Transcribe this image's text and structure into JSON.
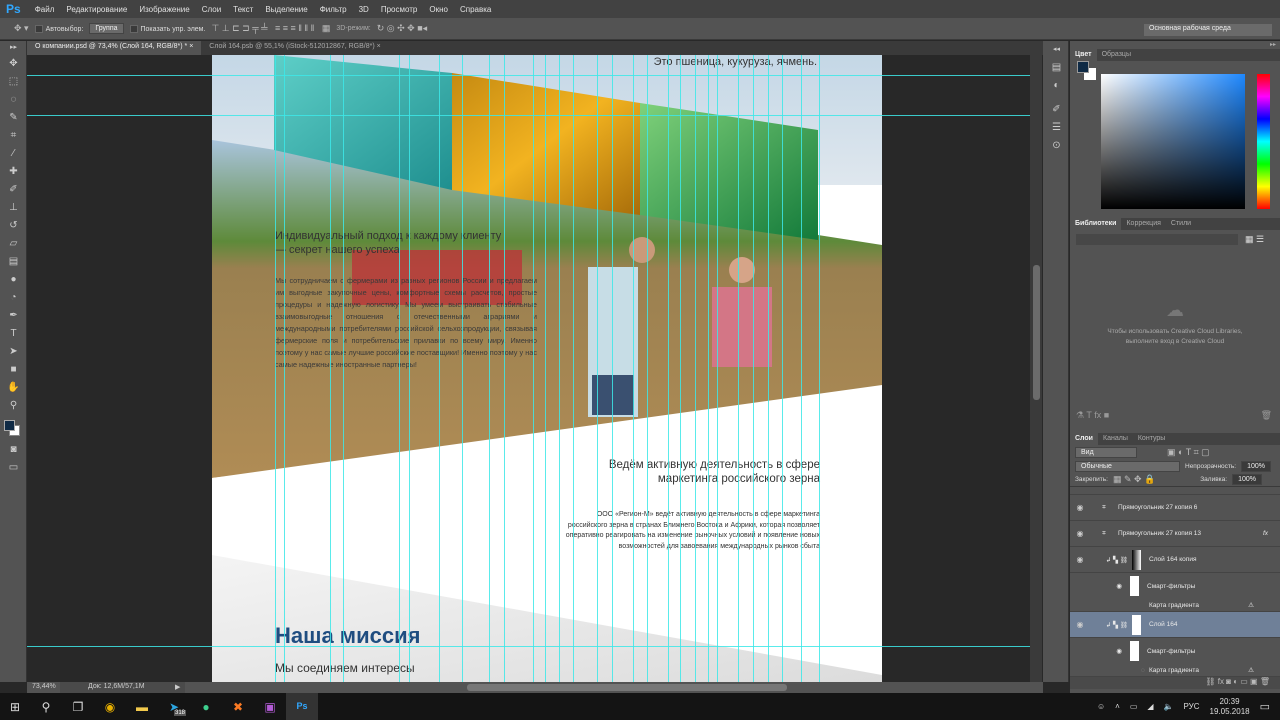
{
  "app": {
    "logo": "Ps"
  },
  "menu": [
    "Файл",
    "Редактирование",
    "Изображение",
    "Слои",
    "Текст",
    "Выделение",
    "Фильтр",
    "3D",
    "Просмотр",
    "Окно",
    "Справка"
  ],
  "options": {
    "autoselect": "Автовыбор:",
    "group": "Группа",
    "show_controls": "Показать упр. элем.",
    "mode3d": "3D-режим:",
    "workspace": "Основная рабочая среда"
  },
  "tabs": [
    {
      "label": "О компании.psd @ 73,4% (Слой 164, RGB/8*) *"
    },
    {
      "label": "Слой 164.psb @ 55,1% (iStock-512012867, RGB/8*)"
    }
  ],
  "document": {
    "top_text": "Это пшеница, кукуруза, ячмень.",
    "heading1": "Индивидуальный подход к каждому клиенту — секрет нашего успеха",
    "para1": "Мы сотрудничаем с фермерами из разных регионов России и предлагаем им выгодные закупочные цены, комфортные схемы расчетов, простые процедуры и надежную логистику. Мы умеем выстраивать стабильные взаимовыгодные отношения с отечественными аграриями и международными потребителями российской сельхозпродукции, связывая фермерские поля и потребительские прилавки по всему миру. Именно поэтому у нас самые лучшие российские поставщики! Именно поэтому у нас самые надежные иностранные партнеры!",
    "heading2": "Ведём активную деятельность в сфере маркетинга российского зерна",
    "para2": "ООО «Регион-М» ведёт активную деятельность в сфере маркетинга российского зерна в странах Ближнего Востока и Африки, которая позволяет оперативно реагировать на изменение рыночных условий и появление новых возможностей для завоевания международных рынков сбыта",
    "mission_title": "Наша миссия",
    "mission_text": "Мы соединяем интересы"
  },
  "status": {
    "zoom": "73,44%",
    "doc": "Док: 12,6M/57,1M"
  },
  "color_panel": {
    "tabs": [
      "Цвет",
      "Образцы"
    ],
    "fg": "#0f2a45",
    "bg": "#ffffff"
  },
  "libraries": {
    "tabs": [
      "Библиотеки",
      "Коррекция",
      "Стили"
    ],
    "message1": "Чтобы использовать Creative Cloud Libraries,",
    "message2": "выполните вход в Creative Cloud"
  },
  "layers": {
    "tabs": [
      "Слои",
      "Каналы",
      "Контуры"
    ],
    "filter": "Вид",
    "blend": "Обычные",
    "opacity_label": "Непрозрачность:",
    "opacity": "100%",
    "lock_label": "Закрепить:",
    "fill_label": "Заливка:",
    "fill": "100%",
    "items": [
      {
        "name": "Прямоугольник 27 копия 6"
      },
      {
        "name": "Прямоугольник 27 копия 13",
        "fx": "fx"
      },
      {
        "name": "Слой 164 копия"
      },
      {
        "name": "Смарт-фильтры"
      },
      {
        "name": "Карта градиента"
      },
      {
        "name": "Слой 164",
        "selected": true
      },
      {
        "name": "Смарт-фильтры"
      },
      {
        "name": "Карта градиента"
      }
    ]
  },
  "taskbar": {
    "lang": "РУС",
    "time": "20:39",
    "date": "19.05.2018",
    "telegram_badge": "318"
  }
}
